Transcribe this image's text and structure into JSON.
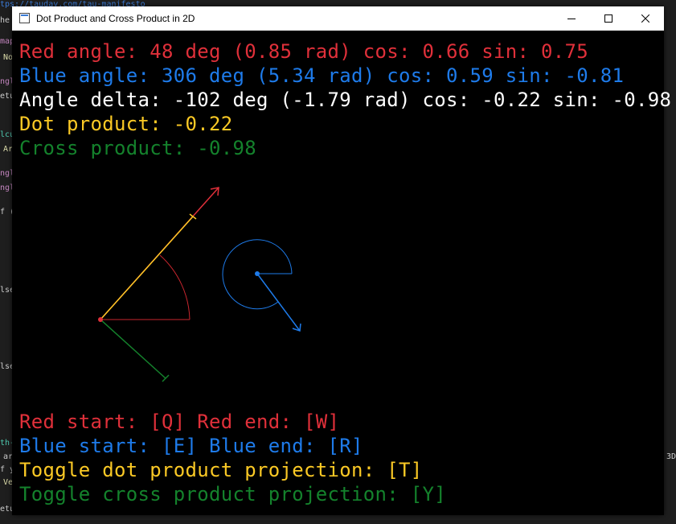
{
  "background": {
    "url_fragment": "tps://tauday.com/tau-manifesto",
    "fragments": [
      "he",
      "map",
      "No",
      "ngl",
      "etu",
      "lcu",
      "Ar",
      "ngl",
      "ngl",
      "f (",
      "lse",
      "lse",
      "th-",
      "ar",
      "f y",
      "Ve",
      "etu",
      "3D"
    ]
  },
  "window": {
    "title": "Dot Product and Cross Product in 2D",
    "minimize_icon": "minimize-icon",
    "maximize_icon": "maximize-icon",
    "close_icon": "close-icon"
  },
  "colors": {
    "red": "#e0303a",
    "blue": "#1e7bea",
    "white": "#ffffff",
    "yellow": "#fbc925",
    "green": "#14822c"
  },
  "hud": {
    "red_angle": "Red angle: 48 deg (0.85 rad) cos: 0.66 sin: 0.75",
    "blue_angle": "Blue angle: 306 deg (5.34 rad) cos: 0.59 sin: -0.81",
    "angle_delta": "Angle delta: -102 deg (-1.79 rad) cos: -0.22 sin: -0.98",
    "dot_product": "Dot product: -0.22",
    "cross_product": "Cross product: -0.98"
  },
  "controls": {
    "red": "Red start: [Q] Red end: [W]",
    "blue": "Blue start: [E] Blue end: [R]",
    "toggle_dot": "Toggle dot product projection: [T]",
    "toggle_cross": "Toggle cross product projection: [Y]"
  }
}
